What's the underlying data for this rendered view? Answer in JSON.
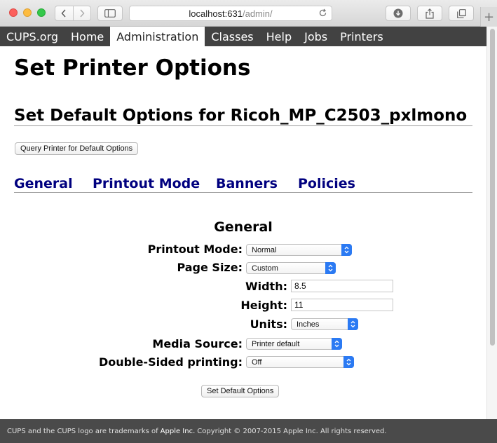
{
  "browser": {
    "url_host": "localhost:631",
    "url_path": "/admin/",
    "new_tab": "+"
  },
  "nav": {
    "items": [
      "CUPS.org",
      "Home",
      "Administration",
      "Classes",
      "Help",
      "Jobs",
      "Printers"
    ],
    "active": "Administration"
  },
  "page": {
    "title": "Set Printer Options",
    "subtitle": "Set Default Options for Ricoh_MP_C2503_pxlmono",
    "query_button": "Query Printer for Default Options",
    "tabs": [
      "General",
      "Printout Mode",
      "Banners",
      "Policies"
    ],
    "section_title": "General",
    "fields": {
      "printout_mode": {
        "label": "Printout Mode:",
        "value": "Normal"
      },
      "page_size": {
        "label": "Page Size:",
        "value": "Custom"
      },
      "width": {
        "label": "Width:",
        "value": "8.5"
      },
      "height": {
        "label": "Height:",
        "value": "11"
      },
      "units": {
        "label": "Units:",
        "value": "Inches"
      },
      "media_source": {
        "label": "Media Source:",
        "value": "Printer default"
      },
      "duplex": {
        "label": "Double-Sided printing:",
        "value": "Off"
      }
    },
    "submit_button": "Set Default Options"
  },
  "footer": {
    "prefix": "CUPS and the CUPS logo are trademarks of",
    "company": "Apple Inc.",
    "suffix": "Copyright © 2007-2015 Apple Inc. All rights reserved."
  },
  "colors": {
    "nav_bg": "#424242",
    "link": "#00007f",
    "select_arrow": "#2b7af3"
  }
}
